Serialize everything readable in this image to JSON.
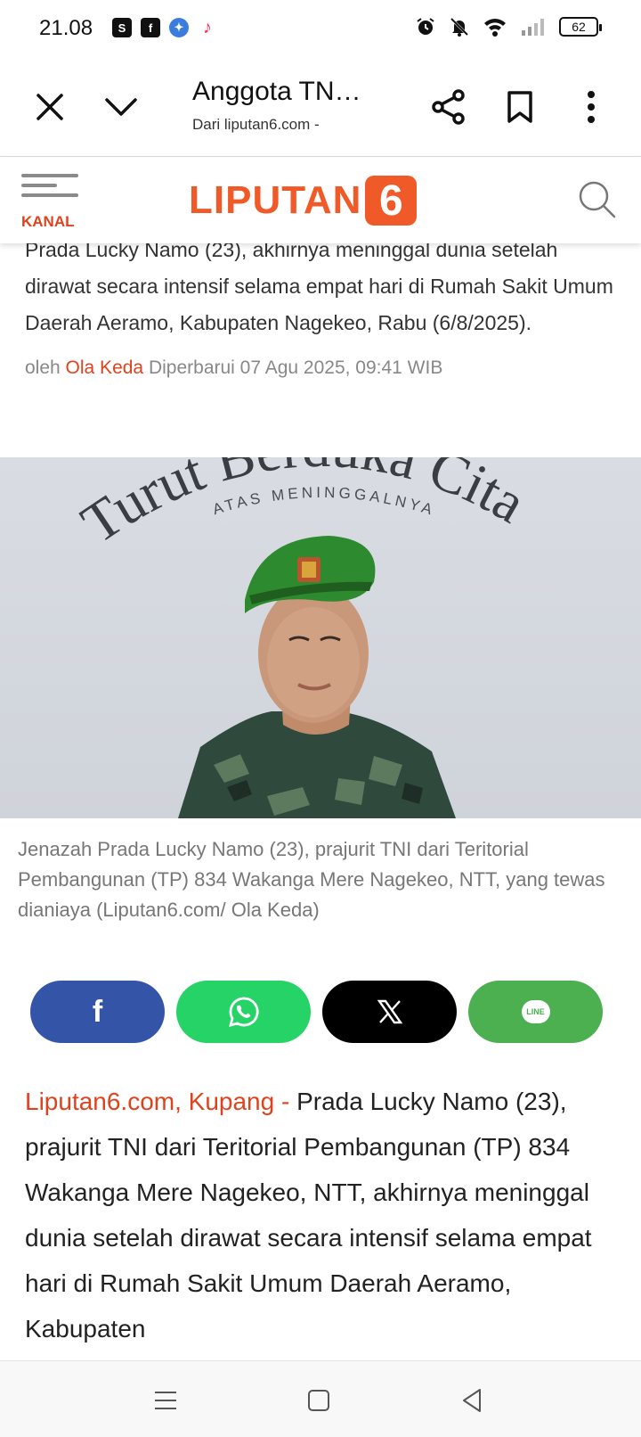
{
  "status_bar": {
    "time": "21.08",
    "battery": "62",
    "app_icons": [
      "shopee-icon",
      "facebook-icon",
      "messenger-icon",
      "tiktok-icon"
    ]
  },
  "toolbar": {
    "title": "Anggota TN…",
    "subtitle": "Dari liputan6.com -"
  },
  "site_header": {
    "menu_label": "KANAL",
    "logo_text": "LIPUTAN",
    "logo_number": "6",
    "brand_color": "#f05a28"
  },
  "article": {
    "lead": "Prada Lucky Namo (23), akhirnya meninggal dunia setelah dirawat secara intensif selama empat hari di Rumah Sakit Umum Daerah Aeramo, Kabupaten Nagekeo, Rabu (6/8/2025).",
    "byline_prefix": "oleh",
    "author": "Ola Keda",
    "updated": "Diperbarui 07 Agu 2025, 09:41 WIB",
    "photo_overlay_title": "Turut Berduka Cita",
    "photo_overlay_subtitle": "ATAS MENINGGALNYA",
    "caption": "Jenazah Prada Lucky Namo (23), prajurit TNI dari Teritorial Pembangunan (TP) 834 Wakanga Mere Nagekeo, NTT, yang tewas dianiaya (Liputan6.com/ Ola Keda)",
    "dateline": "Liputan6.com, Kupang -",
    "body": " Prada Lucky Namo (23), prajurit TNI dari Teritorial Pembangunan (TP) 834 Wakanga Mere Nagekeo, NTT, akhirnya meninggal dunia setelah dirawat secara intensif selama empat hari di Rumah Sakit Umum Daerah Aeramo, Kabupaten"
  },
  "share": {
    "facebook_label": "f",
    "line_label": "LINE",
    "colors": {
      "facebook": "#3454a8",
      "whatsapp": "#25d366",
      "x": "#000000",
      "line": "#4caf50"
    }
  }
}
